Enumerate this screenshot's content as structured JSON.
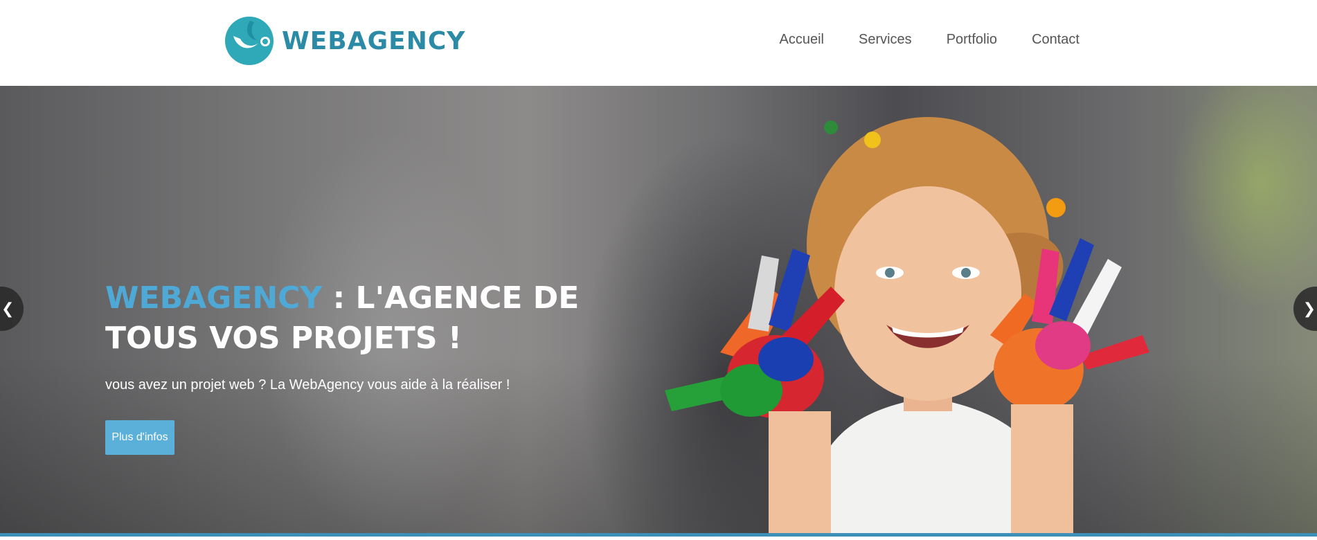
{
  "brand": {
    "name": "WEBAGENCY",
    "color": "#2b8ba6",
    "logo_icon": "webagency-logo-icon"
  },
  "nav": {
    "items": [
      {
        "label": "Accueil"
      },
      {
        "label": "Services"
      },
      {
        "label": "Portfolio"
      },
      {
        "label": "Contact"
      }
    ]
  },
  "hero": {
    "title_accent": "WEBAGENCY",
    "title_rest": " : L'AGENCE DE TOUS VOS PROJETS !",
    "subtitle": "vous avez un projet web ? La WebAgency vous aide à la réaliser !",
    "button_label": "Plus d'infos",
    "accent_color": "#4ea9d6",
    "button_color": "#5bb0d9",
    "prev_icon": "chevron-left-icon",
    "next_icon": "chevron-right-icon"
  }
}
